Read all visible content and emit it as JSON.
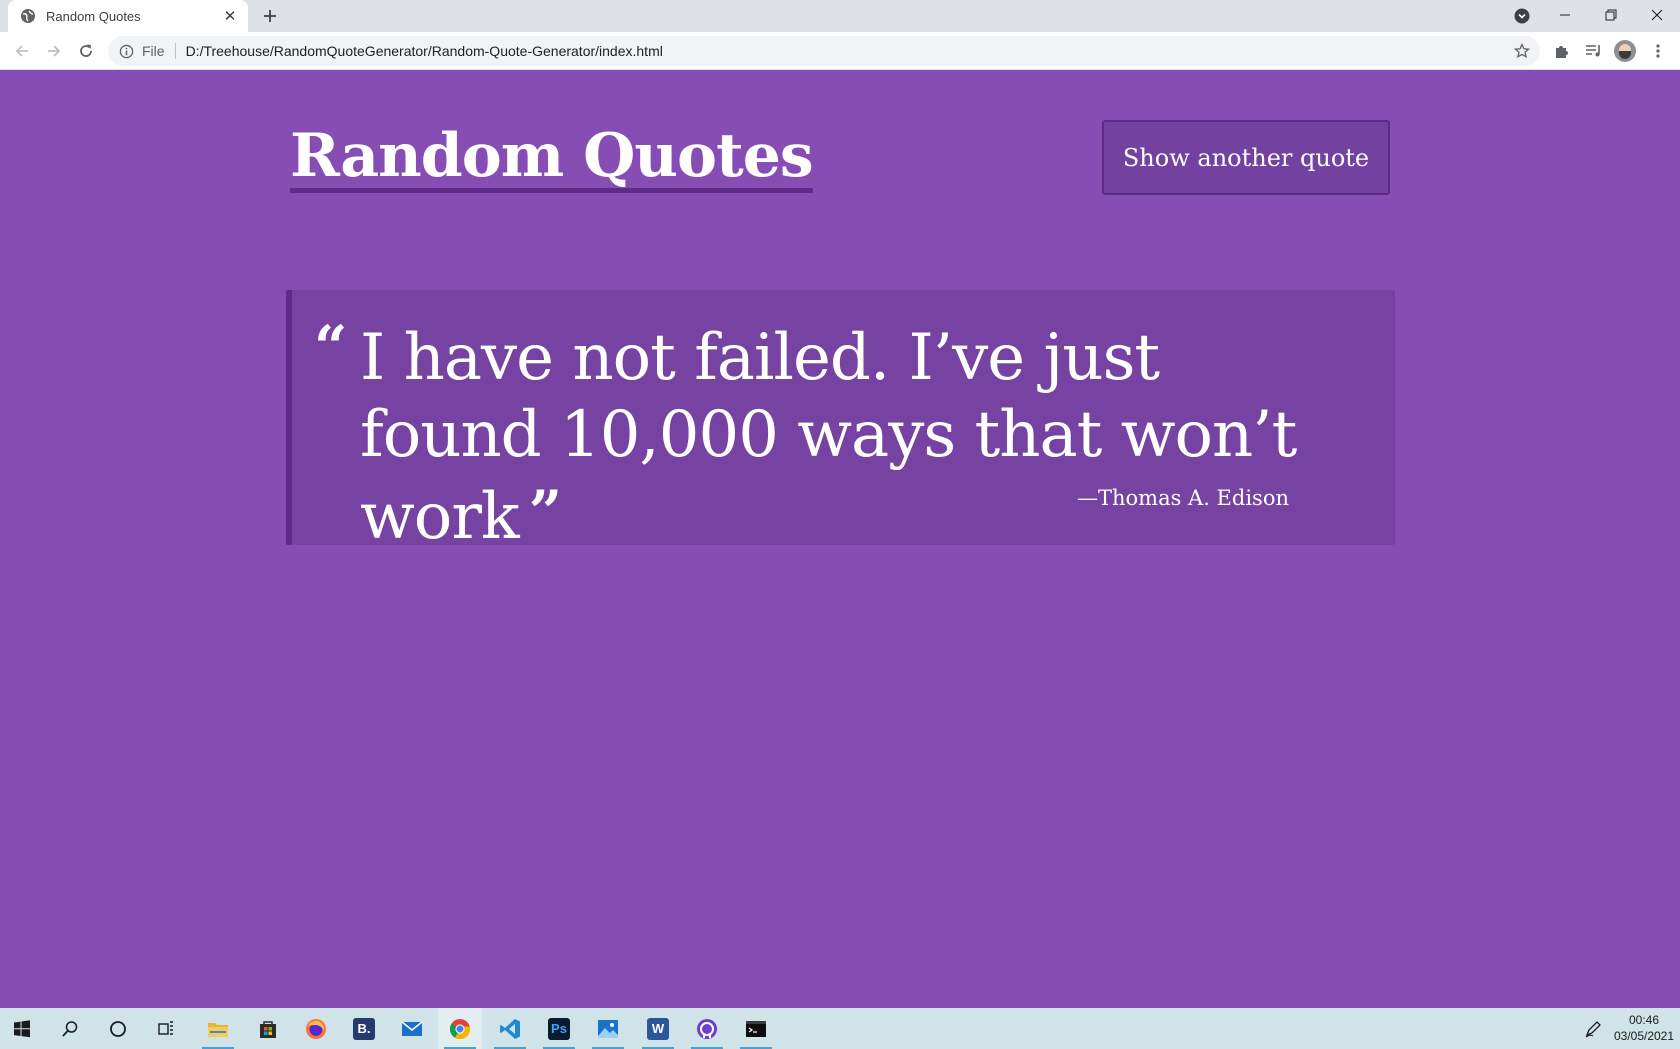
{
  "browser": {
    "tab": {
      "title": "Random Quotes",
      "close_icon": "close-icon",
      "favicon": "globe-icon"
    },
    "new_tab_icon": "plus-icon",
    "omnibox": {
      "scheme": "File",
      "url": "D:/Treehouse/RandomQuoteGenerator/Random-Quote-Generator/index.html"
    },
    "window_controls": {
      "minimize": "—",
      "restore": "❐",
      "close": "✕"
    }
  },
  "page": {
    "title": "Random Quotes",
    "button_label": "Show another quote",
    "quote": {
      "open_mark": "“",
      "text": "I have not failed. I’ve just found 10,000 ways that won’t work",
      "close_mark": "”",
      "source": "—Thomas A. Edison"
    },
    "colors": {
      "background": "#864db4",
      "quote_box": "#7743a2",
      "button": "#7342a0",
      "accent_border": "#5e2b89",
      "text": "#ffffff"
    }
  },
  "taskbar": {
    "apps": [
      "start",
      "search",
      "cortana",
      "task-view",
      "file-explorer",
      "microsoft-store",
      "firefox",
      "bootstrap-studio",
      "mail",
      "chrome",
      "vscode",
      "photoshop",
      "photos",
      "word",
      "github-desktop",
      "terminal"
    ],
    "clock": {
      "time": "00:46",
      "date": "03/05/2021"
    }
  }
}
